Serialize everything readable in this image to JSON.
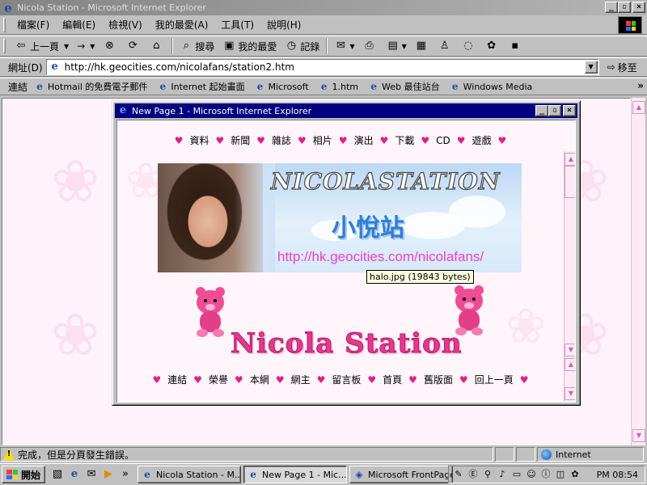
{
  "window": {
    "title": "Nicola Station - Microsoft Internet Explorer",
    "buttons": {
      "minimize": "_",
      "maximize": "▫",
      "close": "×"
    }
  },
  "menu": [
    "檔案(F)",
    "編輯(E)",
    "檢視(V)",
    "我的最愛(A)",
    "工具(T)",
    "說明(H)"
  ],
  "toolbar": {
    "back": "上一頁",
    "forward": "→",
    "search": "搜尋",
    "favorites": "我的最愛",
    "history": "記錄"
  },
  "address": {
    "label": "網址(D)",
    "url": "http://hk.geocities.com/nicolafans/station2.htm",
    "go": "移至"
  },
  "links": {
    "label": "連結",
    "items": [
      "Hotmail 的免費電子郵件",
      "Internet 起始畫面",
      "Microsoft",
      "1.htm",
      "Web 最佳站台",
      "Windows Media"
    ],
    "more": "»"
  },
  "popup": {
    "title": "New Page 1 - Microsoft Internet Explorer",
    "top_nav": [
      "資料",
      "新聞",
      "雜誌",
      "相片",
      "演出",
      "下載",
      "CD",
      "遊戲"
    ],
    "banner": {
      "logo": "NICOLASTATION",
      "cn_title": "小悅站",
      "url": "http://hk.geocities.com/nicolafans/"
    },
    "tooltip": "halo.jpg (19843 bytes)",
    "station_title": "Nicola Station",
    "bottom_nav": [
      "連結",
      "榮譽",
      "本網",
      "網主",
      "留言板",
      "首頁",
      "舊版面",
      "回上一頁"
    ]
  },
  "status": {
    "message": "完成，但是分頁發生錯誤。",
    "zone": "Internet"
  },
  "taskbar": {
    "start": "開始",
    "quick_more": "»",
    "tasks": [
      "Nicola Station - M...",
      "New Page 1 - Mic...",
      "Microsoft FrontPage"
    ],
    "clock": "PM 08:54"
  },
  "colors": {
    "page_bg": "#fff3fb",
    "accent_pink": "#e0208a",
    "popup_title_bg": "#000080",
    "banner_url": "#ee40c8"
  }
}
